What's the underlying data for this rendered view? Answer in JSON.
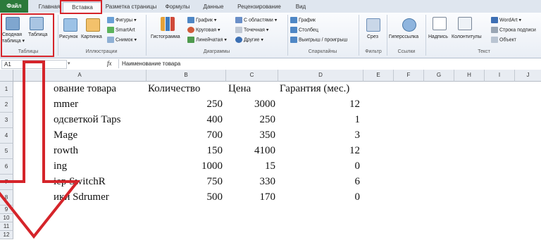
{
  "tabs": {
    "file": "Файл",
    "home": "Главная",
    "insert": "Вставка",
    "page_layout": "Разметка страницы",
    "formulas": "Формулы",
    "data": "Данные",
    "review": "Рецензирование",
    "view": "Вид"
  },
  "ribbon": {
    "tables": {
      "pivot_line1": "Сводная",
      "pivot_line2": "таблица ▾",
      "table": "Таблица",
      "group": "Таблицы"
    },
    "illustrations": {
      "picture": "Рисунок",
      "clipart": "Картинка",
      "shapes": "Фигуры ▾",
      "smartart": "SmartArt",
      "screenshot": "Снимок ▾",
      "group": "Иллюстрации"
    },
    "charts": {
      "histogram": "Гистограмма",
      "line": "График ▾",
      "pie": "Круговая ▾",
      "bar": "Линейчатая ▾",
      "area": "С областями ▾",
      "scatter": "Точечная ▾",
      "other": "Другие ▾",
      "group": "Диаграммы"
    },
    "sparklines": {
      "line": "График",
      "column": "Столбец",
      "winloss": "Выигрыш / проигрыш",
      "group": "Спарклайны"
    },
    "filter": {
      "slicer": "Срез",
      "group": "Фильтр"
    },
    "links": {
      "hyperlink": "Гиперссылка",
      "group": "Ссылки"
    },
    "text": {
      "textbox": "Надпись",
      "header": "Колонтитулы",
      "wordart": "WordArt ▾",
      "signature": "Строка подписи",
      "object": "Объект",
      "group": "Текст"
    }
  },
  "formula_bar": {
    "name_box": "A1",
    "fx": "fx",
    "value": "Наименование товара"
  },
  "columns": [
    "A",
    "B",
    "C",
    "D",
    "E",
    "F",
    "G",
    "H",
    "I",
    "J"
  ],
  "rows": [
    "1",
    "2",
    "3",
    "4",
    "5",
    "6",
    "7",
    "8",
    "9",
    "10",
    "11",
    "12"
  ],
  "table": {
    "headers": [
      "ование товара",
      "Количество",
      "Цена",
      "Гарантия (мес.)"
    ],
    "rows": [
      {
        "name": "mmer",
        "qty": "250",
        "price": "3000",
        "warranty": "12"
      },
      {
        "name": "одсветкой Taps",
        "qty": "400",
        "price": "250",
        "warranty": "1"
      },
      {
        "name": "Mage",
        "qty": "700",
        "price": "350",
        "warranty": "3"
      },
      {
        "name": "rowth",
        "qty": "150",
        "price": "4100",
        "warranty": "12"
      },
      {
        "name": "ing",
        "qty": "1000",
        "price": "15",
        "warranty": "0"
      },
      {
        "name": "iep SwitchR",
        "qty": "750",
        "price": "330",
        "warranty": "6"
      },
      {
        "name": "ики Sdrumer",
        "qty": "500",
        "price": "170",
        "warranty": "0"
      }
    ]
  },
  "colors": {
    "highlight": "#d5242a",
    "file_tab": "#2c7a3b",
    "header_bg": "#e8ecf2"
  }
}
